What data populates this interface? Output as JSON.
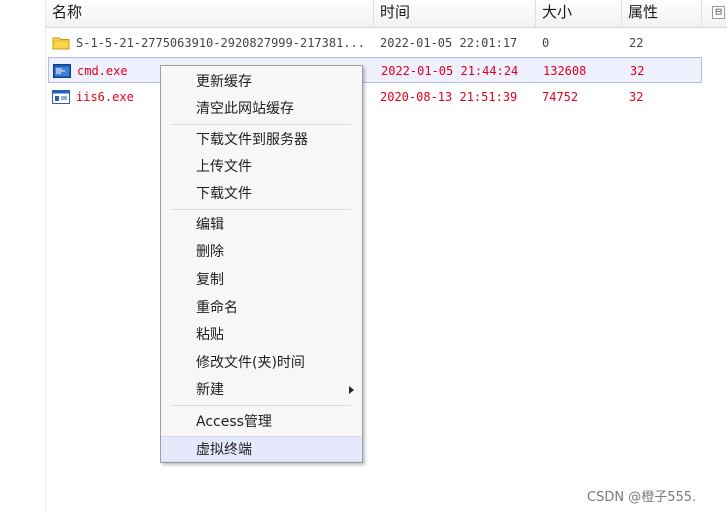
{
  "columns": {
    "name": "名称",
    "time": "时间",
    "size": "大小",
    "attr": "属性"
  },
  "collapse_glyph": "⊟",
  "files": [
    {
      "icon": "folder-icon",
      "name": "S-1-5-21-2775063910-2920827999-217381...",
      "time": "2022-01-05 22:01:17",
      "size": "0",
      "attr": "22"
    },
    {
      "icon": "exe-icon",
      "name": "cmd.exe",
      "time": "2022-01-05 21:44:24",
      "size": "132608",
      "attr": "32"
    },
    {
      "icon": "exe-icon",
      "name": "iis6.exe",
      "time": "2020-08-13 21:51:39",
      "size": "74752",
      "attr": "32"
    }
  ],
  "context_menu": {
    "items": [
      "更新缓存",
      "清空此网站缓存",
      "下载文件到服务器",
      "上传文件",
      "下载文件",
      "编辑",
      "删除",
      "复制",
      "重命名",
      "粘贴",
      "修改文件(夹)时间",
      "新建",
      "Access管理",
      "虚拟终端"
    ]
  },
  "colors": {
    "exe_text": "#e0001b",
    "selection_bg": "#eef0fd",
    "menu_hover_bg": "#e6e9fb"
  },
  "watermark": "CSDN @橙子555."
}
